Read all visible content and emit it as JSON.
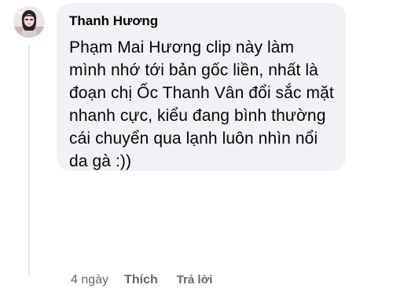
{
  "comment": {
    "author": "Thanh Hương",
    "text_lines": [
      "Phạm Mai Hương clip này làm",
      "mình nhớ tới bản gốc liền, nhất là",
      "đoạn chị Ốc Thanh Vân đổi sắc mặt",
      "nhanh cực, kiểu đang bình thường",
      "cái chuyển qua lạnh luôn nhìn nổi",
      "da gà :))"
    ],
    "time": "4 ngày",
    "like_label": "Thích",
    "reply_label": "Trả lời"
  },
  "colors": {
    "bubble_bg": "#f0f2f5",
    "text": "#050505",
    "meta": "#65676b"
  },
  "icons": {
    "avatar": "user-avatar-photo"
  }
}
